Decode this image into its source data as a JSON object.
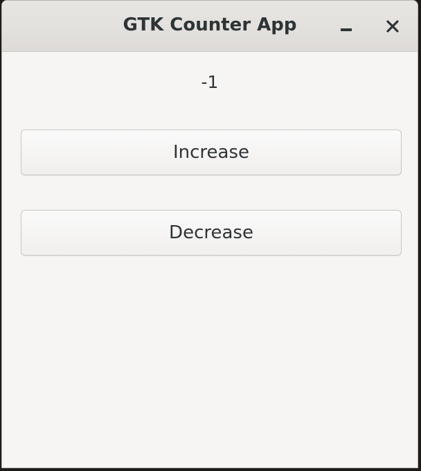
{
  "window": {
    "title": "GTK Counter App",
    "controls": {
      "minimize_icon": "minimize-icon",
      "close_icon": "close-icon",
      "close_glyph": "✕"
    }
  },
  "counter": {
    "value": "-1"
  },
  "buttons": {
    "increase_label": "Increase",
    "decrease_label": "Decrease"
  },
  "colors": {
    "window_bg": "#f6f5f4",
    "titlebar_bg": "#dedbd8",
    "text": "#2e3436"
  }
}
